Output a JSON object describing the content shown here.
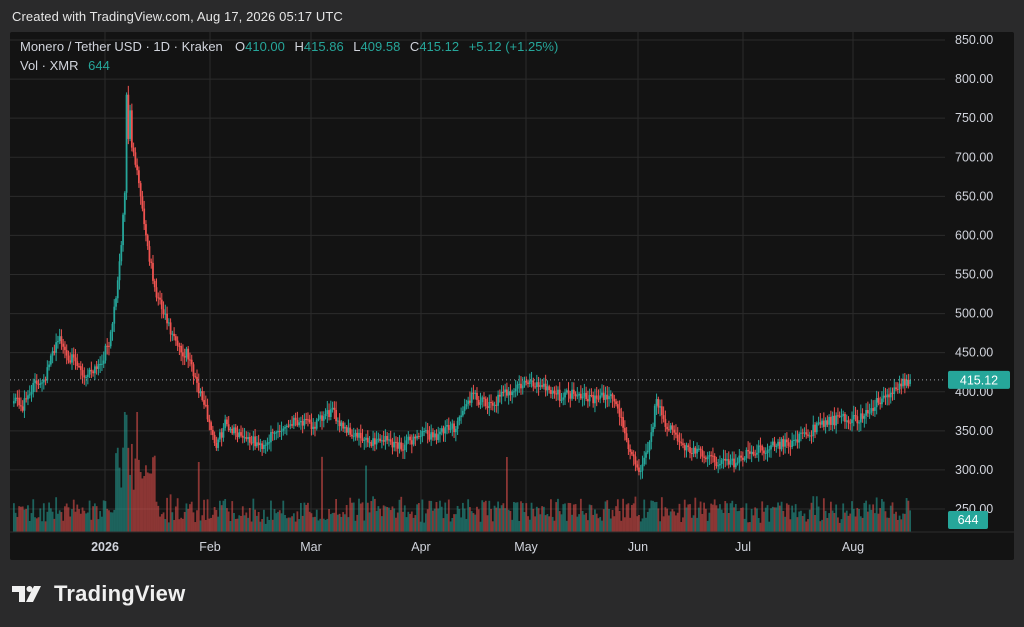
{
  "header": {
    "created_text": "Created with TradingView.com, Aug 17, 2026 05:17 UTC"
  },
  "legend": {
    "symbol": "Monero / Tether USD · 1D · Kraken",
    "o_label": "O",
    "o_value": "410.00",
    "h_label": "H",
    "h_value": "415.86",
    "l_label": "L",
    "l_value": "409.58",
    "c_label": "C",
    "c_value": "415.12",
    "change": "+5.12 (+1.25%)",
    "vol_label": "Vol · XMR",
    "vol_value": "644"
  },
  "colors": {
    "up": "#26a69a",
    "down": "#ef5350",
    "grid": "#2b2b2b",
    "axis_text": "#d1d4dc",
    "background": "#131313"
  },
  "footer": {
    "brand": "TradingView",
    "logo_icon": "tradingview-logo-icon"
  },
  "chart_data": {
    "type": "candlestick",
    "symbol": "Monero / Tether USD",
    "interval": "1D",
    "exchange": "Kraken",
    "y_ticks": [
      "850.00",
      "800.00",
      "750.00",
      "700.00",
      "650.00",
      "600.00",
      "550.00",
      "500.00",
      "450.00",
      "400.00",
      "350.00",
      "300.00",
      "250.00"
    ],
    "ylim": [
      250,
      850
    ],
    "x_ticks": [
      "2026",
      "Feb",
      "Mar",
      "Apr",
      "May",
      "Jun",
      "Jul",
      "Aug"
    ],
    "last_price": "415.12",
    "last_volume": "644",
    "grid": true,
    "anchors": [
      [
        0,
        395
      ],
      [
        5,
        380
      ],
      [
        10,
        405
      ],
      [
        18,
        420
      ],
      [
        25,
        470
      ],
      [
        30,
        450
      ],
      [
        40,
        420
      ],
      [
        50,
        440
      ],
      [
        55,
        470
      ],
      [
        60,
        560
      ],
      [
        65,
        720
      ],
      [
        70,
        690
      ],
      [
        75,
        600
      ],
      [
        80,
        530
      ],
      [
        85,
        500
      ],
      [
        90,
        470
      ],
      [
        95,
        450
      ],
      [
        100,
        440
      ],
      [
        105,
        405
      ],
      [
        110,
        370
      ],
      [
        115,
        330
      ],
      [
        120,
        360
      ],
      [
        125,
        350
      ],
      [
        130,
        345
      ],
      [
        140,
        330
      ],
      [
        150,
        350
      ],
      [
        160,
        365
      ],
      [
        170,
        355
      ],
      [
        180,
        375
      ],
      [
        190,
        350
      ],
      [
        200,
        335
      ],
      [
        210,
        340
      ],
      [
        220,
        330
      ],
      [
        230,
        345
      ],
      [
        240,
        345
      ],
      [
        250,
        355
      ],
      [
        255,
        375
      ],
      [
        260,
        395
      ],
      [
        270,
        380
      ],
      [
        280,
        400
      ],
      [
        290,
        410
      ],
      [
        300,
        410
      ],
      [
        310,
        395
      ],
      [
        320,
        400
      ],
      [
        330,
        390
      ],
      [
        340,
        395
      ],
      [
        345,
        365
      ],
      [
        350,
        320
      ],
      [
        355,
        300
      ],
      [
        360,
        320
      ],
      [
        365,
        390
      ],
      [
        370,
        360
      ],
      [
        380,
        330
      ],
      [
        390,
        320
      ],
      [
        400,
        310
      ],
      [
        410,
        310
      ],
      [
        420,
        325
      ],
      [
        430,
        330
      ],
      [
        440,
        335
      ],
      [
        450,
        345
      ],
      [
        460,
        360
      ],
      [
        470,
        365
      ],
      [
        480,
        365
      ],
      [
        490,
        385
      ],
      [
        500,
        400
      ],
      [
        505,
        410
      ],
      [
        509,
        415.12
      ]
    ]
  }
}
